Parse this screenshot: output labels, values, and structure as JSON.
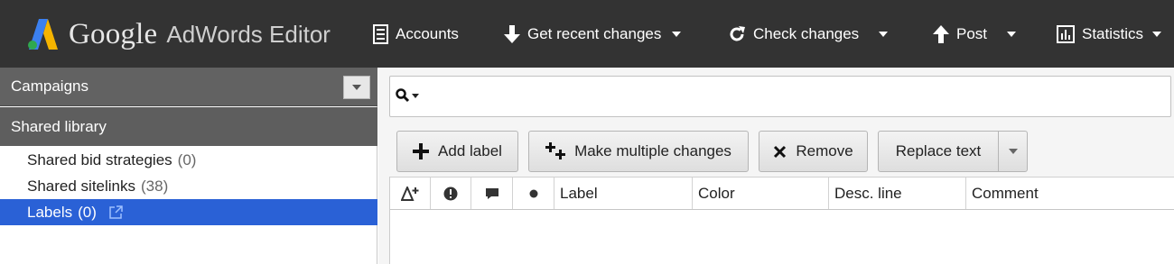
{
  "app": {
    "logo_google": "Google",
    "logo_product": "AdWords Editor",
    "brand_colors": {
      "blue": "#3b80f0",
      "green": "#2fa84f",
      "yellow": "#f5b400"
    }
  },
  "toolbar": {
    "accounts": "Accounts",
    "get_recent_changes": "Get recent changes",
    "check_changes": "Check changes",
    "post": "Post",
    "statistics": "Statistics"
  },
  "sidebar": {
    "campaigns": "Campaigns",
    "shared_library": "Shared library",
    "items": [
      {
        "label": "Shared bid strategies",
        "count": "(0)"
      },
      {
        "label": "Shared sitelinks",
        "count": "(38)"
      },
      {
        "label": "Labels",
        "count": "(0)",
        "selected": true
      }
    ],
    "selected_color": "#2a61d6"
  },
  "search": {
    "placeholder": ""
  },
  "actions": {
    "add_label": "Add label",
    "make_multiple_changes": "Make multiple changes",
    "remove": "Remove",
    "replace_text": "Replace text"
  },
  "grid": {
    "columns": [
      "Label",
      "Color",
      "Desc. line",
      "Comment"
    ]
  }
}
